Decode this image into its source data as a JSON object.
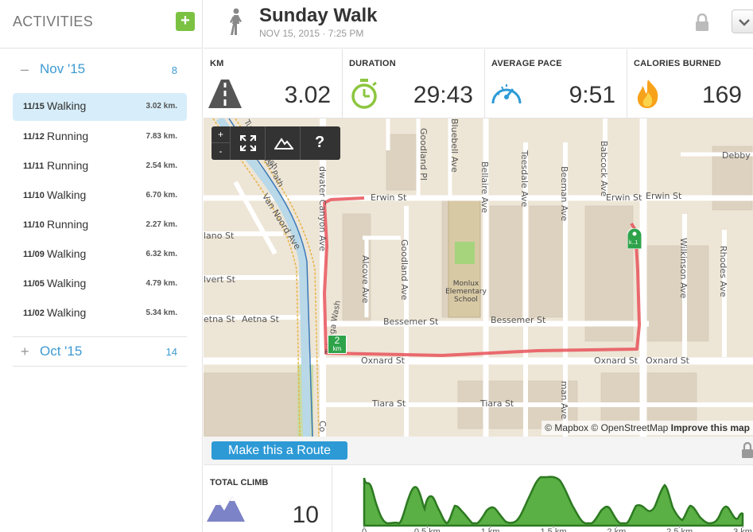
{
  "sidebar": {
    "title": "ACTIVITIES",
    "add_label": "+",
    "months": [
      {
        "toggle": "–",
        "name": "Nov '15",
        "count": "8"
      },
      {
        "toggle": "+",
        "name": "Oct '15",
        "count": "14"
      }
    ],
    "activities": [
      {
        "date": "11/15",
        "type": "Walking",
        "distance": "3.02 km."
      },
      {
        "date": "11/12",
        "type": "Running",
        "distance": "7.83 km."
      },
      {
        "date": "11/11",
        "type": "Running",
        "distance": "2.54 km."
      },
      {
        "date": "11/10",
        "type": "Walking",
        "distance": "6.70 km."
      },
      {
        "date": "11/10",
        "type": "Running",
        "distance": "2.27 km."
      },
      {
        "date": "11/09",
        "type": "Walking",
        "distance": "6.32 km."
      },
      {
        "date": "11/05",
        "type": "Walking",
        "distance": "4.79 km."
      },
      {
        "date": "11/02",
        "type": "Walking",
        "distance": "5.34 km."
      }
    ]
  },
  "header": {
    "title": "Sunday Walk",
    "datetime": "NOV 15, 2015  ·  7:25 PM"
  },
  "stats": {
    "km": {
      "label": "KM",
      "value": "3.02",
      "icon": "road-icon"
    },
    "duration": {
      "label": "DURATION",
      "value": "29:43",
      "icon": "stopwatch-icon"
    },
    "pace": {
      "label": "AVERAGE PACE",
      "value": "9:51",
      "icon": "speedometer-icon"
    },
    "calories": {
      "label": "CALORIES BURNED",
      "value": "169",
      "icon": "flame-icon"
    }
  },
  "map": {
    "controls": {
      "zoom_in": "+",
      "zoom_out": "-",
      "help": "?"
    },
    "streets": {
      "erwin_left": "Erwin St",
      "erwin_right": "Erwin St",
      "erwin_far": "Erwin St",
      "bessemer_left": "Bessemer St",
      "bessemer_right": "Bessemer St",
      "aetna": "Aetna St",
      "aetna_left": "etna St",
      "oxnard_left": "Oxnard St",
      "oxnard_right": "Oxnard St",
      "oxnard_far": "Oxnard St",
      "tiara_left": "Tiara St",
      "tiara_right": "Tiara St",
      "debby": "Debby S",
      "elvert": "lvert St",
      "hanlano": "lano St",
      "van_noord": "Van Noord Ave",
      "tujunga_path": "Tujunga Wash Path",
      "tujunga_wash": "Tujunga Wash",
      "wash": "Wash",
      "canyon": "dwater Canyon Ave",
      "alcove": "Alcove Ave",
      "goodland": "Goodland Ave",
      "goodland_pl": "Goodland Pl",
      "bluebell": "Bluebell Ave",
      "bellaire": "Bellaire Ave",
      "teesdale": "Teesdale Ave",
      "beeman": "Beeman Ave",
      "babcock": "Babcock Ave",
      "wilkinson": "Wilkinson Ave",
      "rhodes": "Rhodes Ave",
      "man_ave": "man Ave",
      "school": "Monlux Elementary School",
      "c_ave": "Co"
    },
    "km_marker": {
      "number": "2",
      "unit": "km"
    },
    "start_label": "k..1",
    "attribution_mapbox": "© Mapbox",
    "attribution_osm": "© OpenStreetMap",
    "attribution_improve": "Improve this map"
  },
  "route_button": "Make this a Route",
  "climb": {
    "label": "TOTAL CLIMB",
    "value": "10"
  },
  "elevation": {
    "x_ticks": [
      "0",
      "0.5 km",
      "1 km",
      "1.5 km",
      "2 km",
      "2.5 km",
      "3 km"
    ],
    "colors": {
      "fill": "#5aaf45",
      "stroke": "#2d7a21"
    }
  }
}
